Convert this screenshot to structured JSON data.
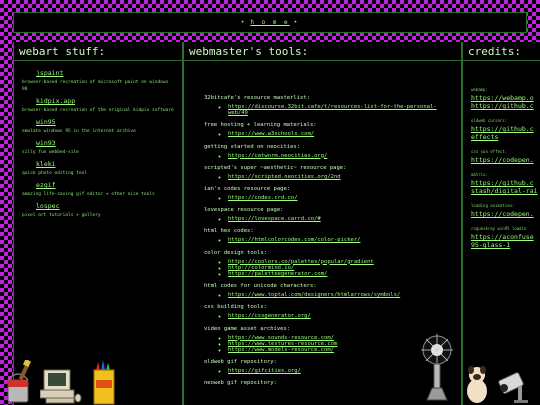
{
  "nav": {
    "left_deco": "•",
    "home": "h o m e",
    "right_deco": "•"
  },
  "left": {
    "title": "webart stuff:",
    "items": [
      {
        "link": "jspaint",
        "desc": "browser-based recreation of microsoft paint on windows 98"
      },
      {
        "link": "kidpix.app",
        "desc": "browser-based recreation of the original kidpix software"
      },
      {
        "link": "win95",
        "desc": "emulate windows 95 in the internet archive"
      },
      {
        "link": "win93",
        "desc": "silly fun webbed-site"
      },
      {
        "link": "kleki",
        "desc": "quick photo editing tool"
      },
      {
        "link": "ezgif",
        "desc": "amazing life-saving gif editor + other nice tools"
      },
      {
        "link": "lospec",
        "desc": "pixel art tutorials + gallery"
      }
    ]
  },
  "middle": {
    "title": "webmaster's tools:",
    "sections": [
      {
        "title": "32bitcafe's resource masterlist:",
        "links": [
          "https://discourse.32bit.cafe/t/resources-list-for-the-personal-web/49"
        ]
      },
      {
        "title": "free hosting + learning materials:",
        "links": [
          "https://www.w3schools.com/"
        ]
      },
      {
        "title": "getting started on neocities:",
        "links": [
          "https://catworm.neocities.org/"
        ]
      },
      {
        "title": "scripted's super ~aesthetic~ resource page:",
        "links": [
          "https://scripted.neocities.org/2nd"
        ]
      },
      {
        "title": "ian's codes resource page:",
        "links": [
          "https://codes.crd.co/"
        ]
      },
      {
        "title": "lovespace resource page:",
        "links": [
          "https://lovespace.carrd.co/#"
        ]
      },
      {
        "title": "html hex codes:",
        "links": [
          "https://htmlcolorcodes.com/color-picker/"
        ]
      },
      {
        "title": "color design tools:",
        "links": [
          "https://coolors.co/palettes/popular/gradient",
          "http://colormind.io/",
          "https://paletteegenerator.com/"
        ]
      },
      {
        "title": "html codes for unicode characters:",
        "links": [
          "https://www.toptal.com/designers/htmlarrows/symbols/"
        ]
      },
      {
        "title": "css building tools:",
        "links": [
          "https://cssgenerator.org/"
        ]
      },
      {
        "title": "video game asset archives:",
        "links": [
          "https://www.sounds-resource.com/",
          "https://www.textures-resource.com",
          "https://www.models-resource.com/"
        ]
      },
      {
        "title": "oldweb gif repository:",
        "links": [
          "https://gifcities.org/"
        ]
      },
      {
        "title": "neoweb gif repository:",
        "links": []
      }
    ]
  },
  "right": {
    "title": "credits:",
    "items": [
      {
        "label": "webamp:",
        "links": [
          "https://webamp.o",
          "https://github.c"
        ]
      },
      {
        "label": "oldweb cursors:",
        "links": [
          "https://github.c",
          "effects"
        ]
      },
      {
        "label": "css sun effect:",
        "links": [
          "https://codepen."
        ]
      },
      {
        "label": "matrix:",
        "links": [
          "https://github.c",
          "stash/digital-rai"
        ]
      },
      {
        "label": "loading animation:",
        "links": [
          "https://codepen."
        ]
      },
      {
        "label": "rogueskray win95 loadin",
        "links": [
          "https://aconfuse",
          "95-glass-1"
        ]
      }
    ]
  }
}
